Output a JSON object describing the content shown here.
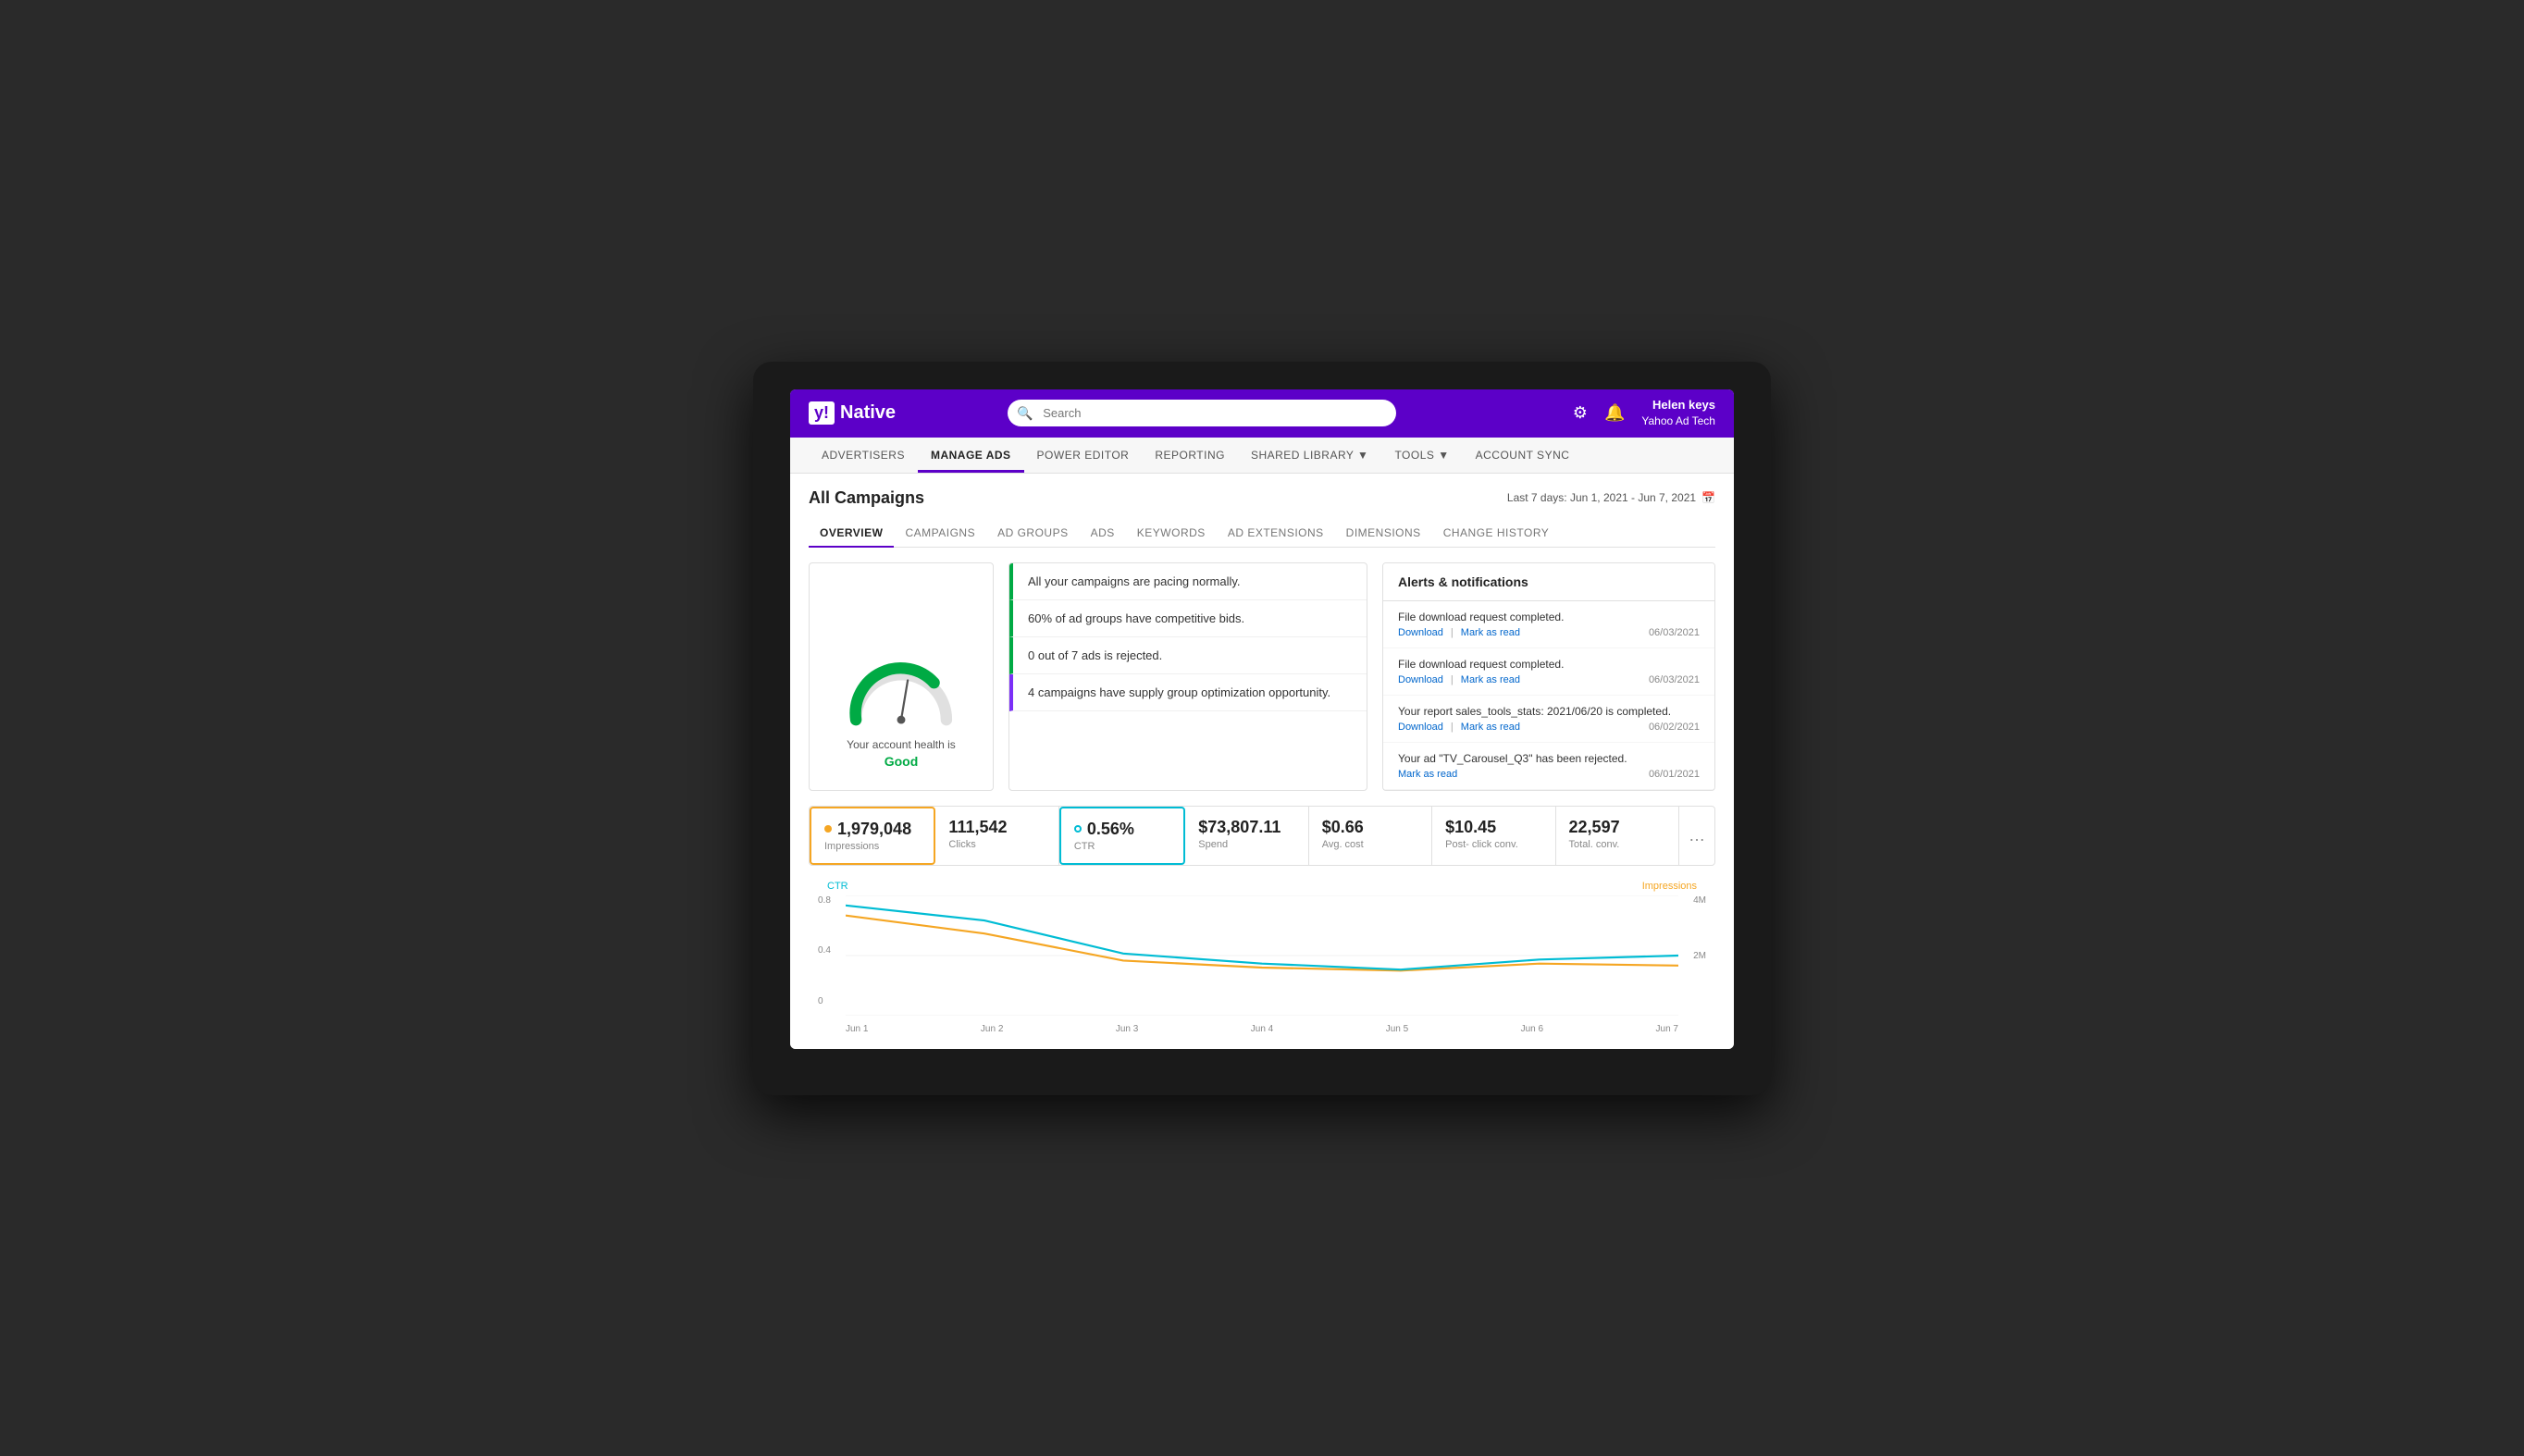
{
  "header": {
    "logo_text": "Native",
    "search_placeholder": "Search",
    "user_name": "Helen keys",
    "user_company": "Yahoo Ad Tech"
  },
  "main_nav": {
    "items": [
      {
        "label": "ADVERTISERS",
        "active": false
      },
      {
        "label": "MANAGE ADS",
        "active": true
      },
      {
        "label": "POWER EDITOR",
        "active": false
      },
      {
        "label": "REPORTING",
        "active": false
      },
      {
        "label": "SHARED LIBRARY",
        "active": false,
        "has_dropdown": true
      },
      {
        "label": "TOOLS",
        "active": false,
        "has_dropdown": true
      },
      {
        "label": "ACCOUNT SYNC",
        "active": false
      }
    ]
  },
  "page": {
    "title": "All Campaigns",
    "date_range": "Last 7 days: Jun 1, 2021 - Jun 7, 2021"
  },
  "sub_tabs": {
    "items": [
      {
        "label": "OVERVIEW",
        "active": true
      },
      {
        "label": "CAMPAIGNS",
        "active": false
      },
      {
        "label": "AD GROUPS",
        "active": false
      },
      {
        "label": "ADS",
        "active": false
      },
      {
        "label": "KEYWORDS",
        "active": false
      },
      {
        "label": "AD EXTENSIONS",
        "active": false
      },
      {
        "label": "DIMENSIONS",
        "active": false
      },
      {
        "label": "CHANGE HISTORY",
        "active": false
      }
    ]
  },
  "health": {
    "text": "Your account health is",
    "status": "Good"
  },
  "info_items": [
    {
      "text": "All your campaigns are pacing normally.",
      "border": "green"
    },
    {
      "text": "60% of ad groups have competitive bids.",
      "border": "green"
    },
    {
      "text": "0 out of 7 ads is rejected.",
      "border": "green"
    },
    {
      "text": "4 campaigns have supply group optimization opportunity.",
      "border": "purple"
    }
  ],
  "alerts": {
    "title": "Alerts & notifications",
    "items": [
      {
        "text": "File download request completed.",
        "actions": [
          "Download",
          "Mark as read"
        ],
        "date": "06/03/2021"
      },
      {
        "text": "File download request completed.",
        "actions": [
          "Download",
          "Mark as read"
        ],
        "date": "06/03/2021"
      },
      {
        "text": "Your report sales_tools_stats: 2021/06/20 is completed.",
        "actions": [
          "Download",
          "Mark as read"
        ],
        "date": "06/02/2021"
      },
      {
        "text": "Your ad \"TV_Carousel_Q3\" has been rejected.",
        "actions": [
          "Mark as read"
        ],
        "date": "06/01/2021"
      }
    ]
  },
  "metrics": [
    {
      "value": "1,979,048",
      "label": "Impressions",
      "dot": "orange",
      "active": "orange"
    },
    {
      "value": "111,542",
      "label": "Clicks",
      "dot": null,
      "active": null
    },
    {
      "value": "0.56%",
      "label": "CTR",
      "dot": "teal",
      "active": "teal"
    },
    {
      "value": "$73,807.11",
      "label": "Spend",
      "dot": null,
      "active": null
    },
    {
      "value": "$0.66",
      "label": "Avg. cost",
      "dot": null,
      "active": null
    },
    {
      "value": "$10.45",
      "label": "Post- click conv.",
      "dot": null,
      "active": null
    },
    {
      "value": "22,597",
      "label": "Total. conv.",
      "dot": null,
      "active": null
    }
  ],
  "chart": {
    "legend_ctr": "CTR",
    "legend_imp": "Impressions",
    "y_left": {
      "values": [
        "0.8",
        "0.4",
        "0"
      ]
    },
    "y_right": {
      "values": [
        "4M",
        "2M",
        ""
      ]
    },
    "x_labels": [
      "Jun 1",
      "Jun 2",
      "Jun 3",
      "Jun 4",
      "Jun 5",
      "Jun 6",
      "Jun 7"
    ]
  }
}
